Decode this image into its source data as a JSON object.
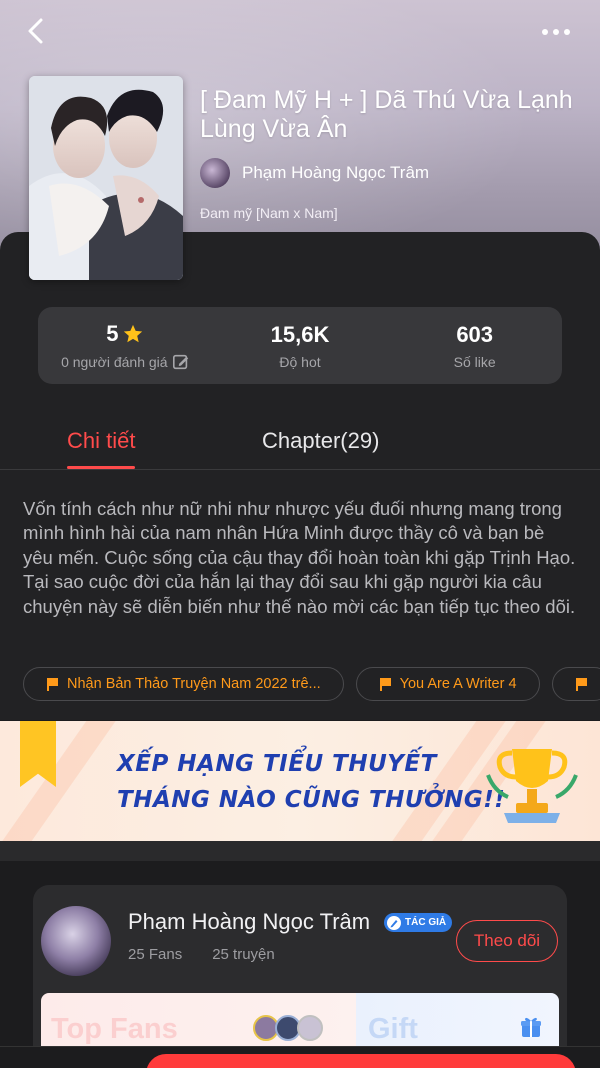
{
  "header": {
    "back_icon": "chevron-left-icon",
    "more_icon": "more-horizontal-icon"
  },
  "book": {
    "title": "[ Đam Mỹ H + ] Dã Thú Vừa Lạnh Lùng Vừa Ân",
    "author": "Phạm Hoàng Ngọc Trâm",
    "genre": "Đam mỹ [Nam x Nam]"
  },
  "stats": {
    "rating_value": "5",
    "rating_label": "0 người đánh giá",
    "hot_value": "15,6K",
    "hot_label": "Độ hot",
    "like_value": "603",
    "like_label": "Số like"
  },
  "tabs": {
    "detail": "Chi tiết",
    "chapter": "Chapter(29)"
  },
  "description": "Vốn tính cách như nữ nhi như nhược yếu đuối nhưng mang trong mình hình hài của nam nhân Hứa Minh được thầy cô và bạn bè yêu mến. Cuộc sống của cậu thay đổi hoàn toàn khi gặp Trịnh Hạo. Tại sao cuộc đời của hắn lại thay đổi sau khi gặp người kia câu chuyện này sẽ diễn biến như thế nào mời các bạn tiếp tục theo dõi.",
  "tags": [
    "Nhận Bản Thảo Truyện Nam 2022 trê...",
    "You Are A Writer 4"
  ],
  "banner": {
    "line1": "XẾP HẠNG TIỂU THUYẾT",
    "line2": "THÁNG NÀO CŨNG THƯỞNG!!"
  },
  "author_card": {
    "name": "Phạm Hoàng Ngọc Trâm",
    "badge": "TÁC GIẢ",
    "fans": "25 Fans",
    "stories": "25 truyện",
    "follow_label": "Theo dõi",
    "top_fans_label": "Top Fans",
    "gift_label": "Gift"
  },
  "colors": {
    "accent": "#ff4b4b",
    "tag_text": "#ff9a1a",
    "star": "#ffc21a",
    "badge": "#2f7be6"
  }
}
